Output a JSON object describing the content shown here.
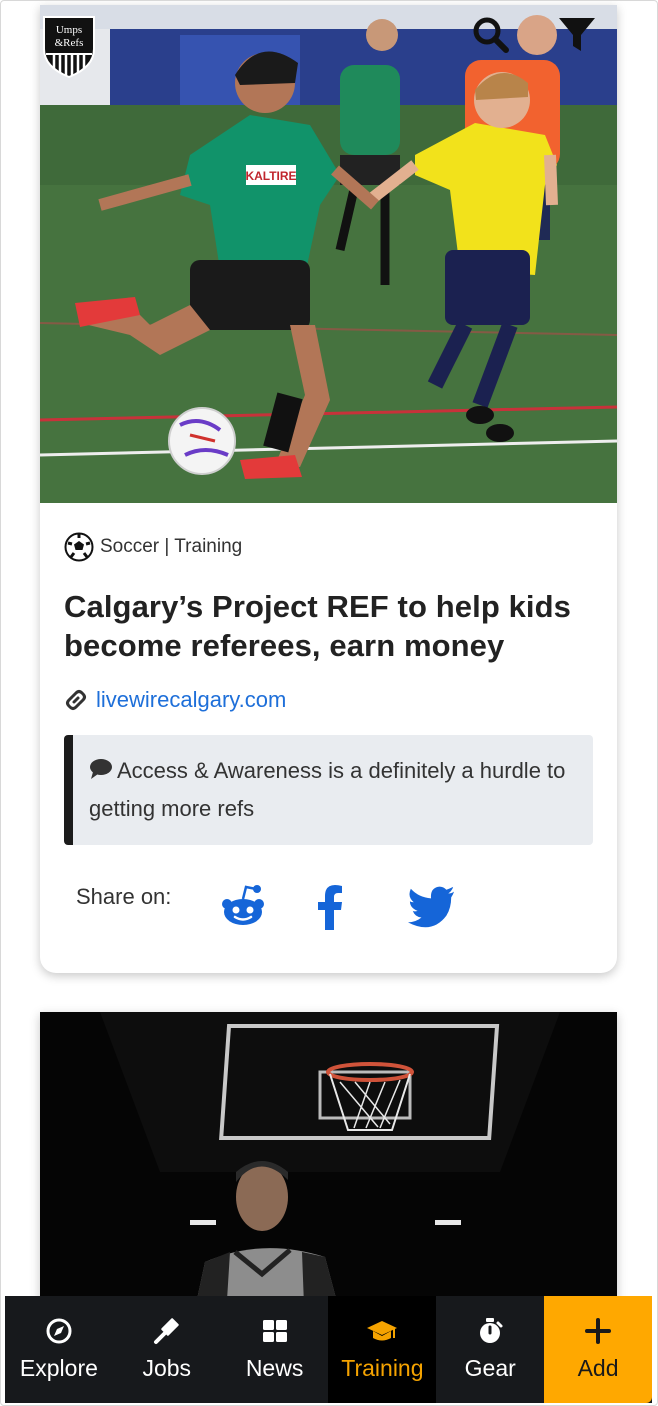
{
  "app": {
    "logo_line1": "Umps",
    "logo_line2": "&Refs"
  },
  "header": {
    "search_icon": "search-icon",
    "filter_icon": "filter-icon"
  },
  "articles": [
    {
      "sport_icon": "soccer-ball-icon",
      "category": "Soccer | Training",
      "title": "Calgary’s Project REF to help kids become referees, earn money",
      "source": "livewirecalgary.com",
      "comment": "Access & Awareness is a definitely a hurdle to getting more refs",
      "share_label": "Share on:",
      "share_icons": [
        "reddit-icon",
        "facebook-icon",
        "twitter-icon"
      ],
      "photo_jersey_sponsor": "KALTIRE"
    },
    {
      "photo_subject": "basketball-referee-photo"
    }
  ],
  "nav": {
    "items": [
      {
        "label": "Explore",
        "icon": "compass-icon"
      },
      {
        "label": "Jobs",
        "icon": "gavel-icon"
      },
      {
        "label": "News",
        "icon": "grid-icon"
      },
      {
        "label": "Training",
        "icon": "graduation-cap-icon"
      },
      {
        "label": "Gear",
        "icon": "stopwatch-icon"
      },
      {
        "label": "Add",
        "icon": "plus-icon"
      }
    ]
  },
  "colors": {
    "accent": "#ffa800",
    "active_nav_text": "#f5a300",
    "link": "#1e6fd9",
    "social": "#1565d8",
    "nav_bg": "#17191c"
  }
}
